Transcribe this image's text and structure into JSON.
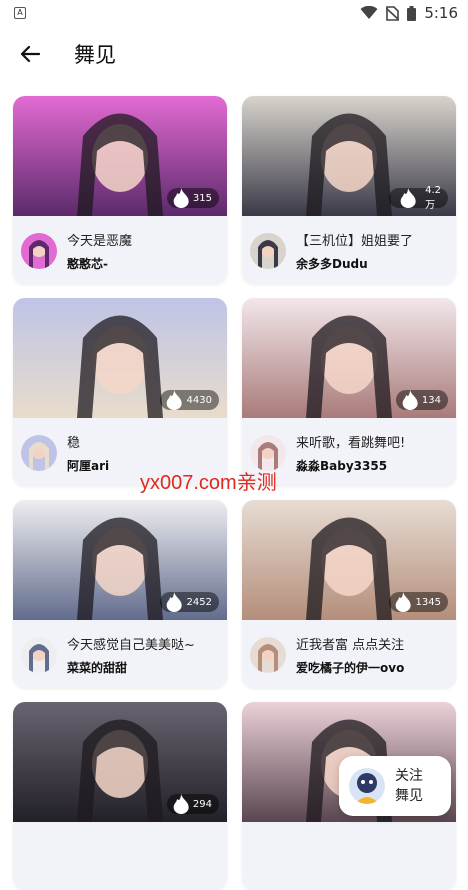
{
  "status": {
    "time": "5:16"
  },
  "header": {
    "title": "舞见"
  },
  "cards": [
    {
      "caption": "今天是恶魔",
      "author": "憨憨芯-",
      "views": "315",
      "bg1": "#e26bd3",
      "bg2": "#5c2a6b"
    },
    {
      "caption": "【三机位】姐姐要了",
      "author": "余多多Dudu",
      "views": "4.2万",
      "bg1": "#d8d3cc",
      "bg2": "#3a3a48"
    },
    {
      "caption": "稳",
      "author": "阿厘ari",
      "views": "4430",
      "bg1": "#bfc4e6",
      "bg2": "#e8dccb"
    },
    {
      "caption": "来听歌，看跳舞吧!",
      "author": "淼淼Baby3355",
      "views": "134",
      "bg1": "#f2e7ea",
      "bg2": "#a97b7a"
    },
    {
      "caption": "今天感觉自己美美哒~",
      "author": "菜菜的甜甜",
      "views": "2452",
      "bg1": "#eeeef2",
      "bg2": "#626c8c"
    },
    {
      "caption": "近我者富 点点关注",
      "author": "爱吃橘子的伊一ovo",
      "views": "1345",
      "bg1": "#e7dcd3",
      "bg2": "#b48e7b"
    },
    {
      "caption": "",
      "author": "",
      "views": "294",
      "bg1": "#6a6470",
      "bg2": "#222028"
    },
    {
      "caption": "",
      "author": "",
      "views": "",
      "bg1": "#ecd1d8",
      "bg2": "#5a4650"
    }
  ],
  "watermark": "yx007.com亲测",
  "follow": {
    "line1": "关注",
    "line2": "舞见"
  }
}
